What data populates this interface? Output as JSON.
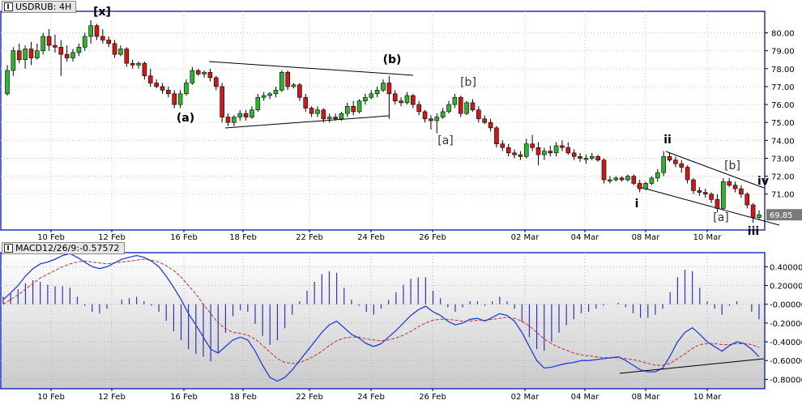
{
  "price_panel": {
    "title": "USDRUB: 4H",
    "last_price_tag": "69.85",
    "colors": {
      "bull": "#2db52d",
      "bear": "#d01818",
      "grid": "#c8c8c8",
      "tag_bg": "#7a7a7a"
    }
  },
  "macd_panel": {
    "title": "MACD12/26/9:-0.57572",
    "colors": {
      "macd": "#1f3fd6",
      "signal": "#c03030",
      "histogram": "#3030c0",
      "bg_top": "#ffffff",
      "bg_bottom": "#c9c9c9"
    }
  },
  "x_axis_labels": [
    "10 Feb",
    "12 Feb",
    "16 Feb",
    "18 Feb",
    "22 Feb",
    "24 Feb",
    "26 Feb",
    "02 Mar",
    "04 Mar",
    "08 Mar",
    "10 Mar"
  ],
  "chart_data": [
    {
      "type": "candlestick",
      "title": "USDRUB: 4H",
      "y_ticks": [
        "80.00",
        "79.00",
        "78.00",
        "77.00",
        "76.00",
        "75.00",
        "74.00",
        "73.00",
        "72.00",
        "71.00"
      ],
      "ylim": [
        69.0,
        81.2
      ],
      "last_price": 69.85,
      "grid": true,
      "wave_labels": [
        "[x]",
        "(a)",
        "(b)",
        "[a]",
        "[b]",
        "ii",
        "i",
        "[b]",
        "[a]",
        "iii",
        "iv"
      ],
      "candles": [
        {
          "o": 76.6,
          "h": 78.2,
          "l": 76.5,
          "c": 77.9
        },
        {
          "o": 77.9,
          "h": 79.2,
          "l": 77.6,
          "c": 79.0
        },
        {
          "o": 79.0,
          "h": 79.4,
          "l": 78.3,
          "c": 78.5
        },
        {
          "o": 78.5,
          "h": 79.3,
          "l": 78.0,
          "c": 79.1
        },
        {
          "o": 79.1,
          "h": 79.5,
          "l": 78.2,
          "c": 78.6
        },
        {
          "o": 78.6,
          "h": 79.4,
          "l": 78.5,
          "c": 79.0
        },
        {
          "o": 79.0,
          "h": 80.0,
          "l": 78.8,
          "c": 79.8
        },
        {
          "o": 79.8,
          "h": 80.2,
          "l": 79.0,
          "c": 79.3
        },
        {
          "o": 79.3,
          "h": 79.9,
          "l": 78.9,
          "c": 79.2
        },
        {
          "o": 79.2,
          "h": 79.6,
          "l": 77.6,
          "c": 78.8
        },
        {
          "o": 78.8,
          "h": 79.3,
          "l": 78.4,
          "c": 78.6
        },
        {
          "o": 78.6,
          "h": 79.1,
          "l": 78.4,
          "c": 78.9
        },
        {
          "o": 78.9,
          "h": 79.4,
          "l": 78.7,
          "c": 79.2
        },
        {
          "o": 79.2,
          "h": 80.0,
          "l": 79.0,
          "c": 79.8
        },
        {
          "o": 79.8,
          "h": 80.7,
          "l": 79.4,
          "c": 80.4
        },
        {
          "o": 80.4,
          "h": 80.5,
          "l": 79.6,
          "c": 79.8
        },
        {
          "o": 79.8,
          "h": 80.2,
          "l": 79.4,
          "c": 79.6
        },
        {
          "o": 79.6,
          "h": 79.8,
          "l": 79.2,
          "c": 79.4
        },
        {
          "o": 79.4,
          "h": 79.6,
          "l": 78.6,
          "c": 78.8
        },
        {
          "o": 78.8,
          "h": 79.3,
          "l": 78.7,
          "c": 79.1
        },
        {
          "o": 79.1,
          "h": 79.2,
          "l": 78.1,
          "c": 78.3
        },
        {
          "o": 78.3,
          "h": 78.5,
          "l": 78.0,
          "c": 78.2
        },
        {
          "o": 78.2,
          "h": 78.4,
          "l": 78.0,
          "c": 78.3
        },
        {
          "o": 78.3,
          "h": 78.4,
          "l": 77.4,
          "c": 77.6
        },
        {
          "o": 77.6,
          "h": 78.0,
          "l": 77.0,
          "c": 77.2
        },
        {
          "o": 77.2,
          "h": 77.4,
          "l": 76.9,
          "c": 77.0
        },
        {
          "o": 77.0,
          "h": 77.2,
          "l": 76.6,
          "c": 76.8
        },
        {
          "o": 76.8,
          "h": 77.0,
          "l": 76.4,
          "c": 76.6
        },
        {
          "o": 76.6,
          "h": 76.8,
          "l": 75.8,
          "c": 76.0
        },
        {
          "o": 76.0,
          "h": 76.8,
          "l": 75.8,
          "c": 76.6
        },
        {
          "o": 76.6,
          "h": 77.4,
          "l": 76.5,
          "c": 77.2
        },
        {
          "o": 77.2,
          "h": 78.1,
          "l": 77.1,
          "c": 77.9
        },
        {
          "o": 77.9,
          "h": 78.0,
          "l": 77.6,
          "c": 77.7
        },
        {
          "o": 77.7,
          "h": 77.9,
          "l": 77.5,
          "c": 77.8
        },
        {
          "o": 77.8,
          "h": 78.0,
          "l": 77.3,
          "c": 77.5
        },
        {
          "o": 77.5,
          "h": 77.6,
          "l": 76.8,
          "c": 77.0
        },
        {
          "o": 77.0,
          "h": 77.2,
          "l": 75.0,
          "c": 75.3
        },
        {
          "o": 75.3,
          "h": 75.5,
          "l": 74.8,
          "c": 75.0
        },
        {
          "o": 75.0,
          "h": 75.4,
          "l": 74.8,
          "c": 75.3
        },
        {
          "o": 75.3,
          "h": 75.7,
          "l": 75.1,
          "c": 75.5
        },
        {
          "o": 75.5,
          "h": 75.7,
          "l": 75.1,
          "c": 75.3
        },
        {
          "o": 75.3,
          "h": 75.9,
          "l": 75.2,
          "c": 75.7
        },
        {
          "o": 75.7,
          "h": 76.6,
          "l": 75.6,
          "c": 76.4
        },
        {
          "o": 76.4,
          "h": 76.7,
          "l": 76.2,
          "c": 76.5
        },
        {
          "o": 76.5,
          "h": 76.7,
          "l": 76.3,
          "c": 76.6
        },
        {
          "o": 76.6,
          "h": 77.0,
          "l": 76.4,
          "c": 76.8
        },
        {
          "o": 76.8,
          "h": 77.9,
          "l": 76.7,
          "c": 77.8
        },
        {
          "o": 77.8,
          "h": 77.9,
          "l": 76.8,
          "c": 77.0
        },
        {
          "o": 77.0,
          "h": 77.2,
          "l": 76.9,
          "c": 77.1
        },
        {
          "o": 77.1,
          "h": 77.2,
          "l": 76.2,
          "c": 76.4
        },
        {
          "o": 76.4,
          "h": 76.6,
          "l": 75.6,
          "c": 75.8
        },
        {
          "o": 75.8,
          "h": 75.9,
          "l": 75.3,
          "c": 75.5
        },
        {
          "o": 75.5,
          "h": 75.9,
          "l": 75.3,
          "c": 75.7
        },
        {
          "o": 75.7,
          "h": 75.8,
          "l": 75.0,
          "c": 75.2
        },
        {
          "o": 75.2,
          "h": 75.5,
          "l": 75.0,
          "c": 75.3
        },
        {
          "o": 75.3,
          "h": 75.5,
          "l": 75.1,
          "c": 75.2
        },
        {
          "o": 75.2,
          "h": 75.6,
          "l": 75.1,
          "c": 75.5
        },
        {
          "o": 75.5,
          "h": 76.1,
          "l": 75.3,
          "c": 75.9
        },
        {
          "o": 75.9,
          "h": 76.2,
          "l": 75.4,
          "c": 75.6
        },
        {
          "o": 75.6,
          "h": 76.3,
          "l": 75.5,
          "c": 76.2
        },
        {
          "o": 76.2,
          "h": 76.6,
          "l": 76.0,
          "c": 76.4
        },
        {
          "o": 76.4,
          "h": 76.8,
          "l": 76.3,
          "c": 76.6
        },
        {
          "o": 76.6,
          "h": 77.0,
          "l": 76.4,
          "c": 76.8
        },
        {
          "o": 76.8,
          "h": 77.4,
          "l": 76.7,
          "c": 77.2
        },
        {
          "o": 77.2,
          "h": 77.6,
          "l": 75.2,
          "c": 76.6
        },
        {
          "o": 76.6,
          "h": 76.8,
          "l": 76.0,
          "c": 76.2
        },
        {
          "o": 76.2,
          "h": 76.4,
          "l": 75.9,
          "c": 76.1
        },
        {
          "o": 76.1,
          "h": 76.7,
          "l": 76.0,
          "c": 76.5
        },
        {
          "o": 76.5,
          "h": 76.6,
          "l": 75.8,
          "c": 76.0
        },
        {
          "o": 76.0,
          "h": 76.2,
          "l": 75.4,
          "c": 75.6
        },
        {
          "o": 75.6,
          "h": 75.7,
          "l": 75.0,
          "c": 75.2
        },
        {
          "o": 75.2,
          "h": 75.4,
          "l": 74.6,
          "c": 75.1
        },
        {
          "o": 75.1,
          "h": 75.5,
          "l": 74.4,
          "c": 75.3
        },
        {
          "o": 75.3,
          "h": 75.8,
          "l": 75.2,
          "c": 75.6
        },
        {
          "o": 75.6,
          "h": 76.2,
          "l": 75.5,
          "c": 76.0
        },
        {
          "o": 76.0,
          "h": 76.6,
          "l": 75.8,
          "c": 76.4
        },
        {
          "o": 76.4,
          "h": 76.5,
          "l": 75.3,
          "c": 75.5
        },
        {
          "o": 75.5,
          "h": 76.2,
          "l": 75.4,
          "c": 76.1
        },
        {
          "o": 76.1,
          "h": 76.3,
          "l": 75.6,
          "c": 75.7
        },
        {
          "o": 75.7,
          "h": 75.9,
          "l": 75.0,
          "c": 75.2
        },
        {
          "o": 75.2,
          "h": 75.4,
          "l": 74.9,
          "c": 75.0
        },
        {
          "o": 75.0,
          "h": 75.2,
          "l": 74.5,
          "c": 74.7
        },
        {
          "o": 74.7,
          "h": 74.8,
          "l": 73.6,
          "c": 73.8
        },
        {
          "o": 73.8,
          "h": 74.0,
          "l": 73.4,
          "c": 73.6
        },
        {
          "o": 73.6,
          "h": 73.8,
          "l": 73.1,
          "c": 73.3
        },
        {
          "o": 73.3,
          "h": 73.5,
          "l": 73.0,
          "c": 73.2
        },
        {
          "o": 73.2,
          "h": 73.4,
          "l": 72.9,
          "c": 73.1
        },
        {
          "o": 73.1,
          "h": 74.1,
          "l": 73.0,
          "c": 73.8
        },
        {
          "o": 73.8,
          "h": 74.3,
          "l": 73.4,
          "c": 73.6
        },
        {
          "o": 73.6,
          "h": 73.9,
          "l": 72.6,
          "c": 73.2
        },
        {
          "o": 73.2,
          "h": 73.6,
          "l": 72.9,
          "c": 73.4
        },
        {
          "o": 73.4,
          "h": 73.7,
          "l": 73.1,
          "c": 73.3
        },
        {
          "o": 73.3,
          "h": 73.9,
          "l": 73.1,
          "c": 73.7
        },
        {
          "o": 73.7,
          "h": 74.0,
          "l": 73.4,
          "c": 73.6
        },
        {
          "o": 73.6,
          "h": 73.9,
          "l": 73.2,
          "c": 73.3
        },
        {
          "o": 73.3,
          "h": 73.5,
          "l": 72.9,
          "c": 73.1
        },
        {
          "o": 73.1,
          "h": 73.3,
          "l": 72.8,
          "c": 73.0
        },
        {
          "o": 73.0,
          "h": 73.2,
          "l": 72.7,
          "c": 73.0
        },
        {
          "o": 73.0,
          "h": 73.3,
          "l": 72.9,
          "c": 73.1
        },
        {
          "o": 73.1,
          "h": 73.2,
          "l": 72.8,
          "c": 72.9
        },
        {
          "o": 72.9,
          "h": 73.0,
          "l": 71.6,
          "c": 71.8
        },
        {
          "o": 71.8,
          "h": 72.0,
          "l": 71.6,
          "c": 71.8
        },
        {
          "o": 71.8,
          "h": 72.0,
          "l": 71.7,
          "c": 71.9
        },
        {
          "o": 71.9,
          "h": 72.0,
          "l": 71.7,
          "c": 71.8
        },
        {
          "o": 71.8,
          "h": 72.1,
          "l": 71.7,
          "c": 72.0
        },
        {
          "o": 72.0,
          "h": 72.1,
          "l": 71.5,
          "c": 71.6
        },
        {
          "o": 71.6,
          "h": 71.8,
          "l": 71.1,
          "c": 71.3
        },
        {
          "o": 71.3,
          "h": 71.7,
          "l": 71.2,
          "c": 71.6
        },
        {
          "o": 71.6,
          "h": 72.0,
          "l": 71.5,
          "c": 71.9
        },
        {
          "o": 71.9,
          "h": 72.4,
          "l": 71.7,
          "c": 72.2
        },
        {
          "o": 72.2,
          "h": 73.4,
          "l": 72.0,
          "c": 73.1
        },
        {
          "o": 73.1,
          "h": 73.3,
          "l": 72.8,
          "c": 72.9
        },
        {
          "o": 72.9,
          "h": 73.1,
          "l": 72.5,
          "c": 72.7
        },
        {
          "o": 72.7,
          "h": 72.9,
          "l": 72.2,
          "c": 72.5
        },
        {
          "o": 72.5,
          "h": 72.6,
          "l": 71.6,
          "c": 71.8
        },
        {
          "o": 71.8,
          "h": 71.9,
          "l": 71.0,
          "c": 71.2
        },
        {
          "o": 71.2,
          "h": 71.4,
          "l": 70.9,
          "c": 71.1
        },
        {
          "o": 71.1,
          "h": 71.3,
          "l": 70.8,
          "c": 71.0
        },
        {
          "o": 71.0,
          "h": 71.1,
          "l": 70.5,
          "c": 70.7
        },
        {
          "o": 70.7,
          "h": 71.0,
          "l": 70.0,
          "c": 70.2
        },
        {
          "o": 70.2,
          "h": 71.9,
          "l": 70.1,
          "c": 71.7
        },
        {
          "o": 71.7,
          "h": 71.9,
          "l": 71.4,
          "c": 71.5
        },
        {
          "o": 71.5,
          "h": 71.7,
          "l": 71.1,
          "c": 71.3
        },
        {
          "o": 71.3,
          "h": 71.5,
          "l": 70.8,
          "c": 71.0
        },
        {
          "o": 71.0,
          "h": 71.1,
          "l": 70.2,
          "c": 70.4
        },
        {
          "o": 70.4,
          "h": 70.5,
          "l": 69.4,
          "c": 69.7
        },
        {
          "o": 69.7,
          "h": 70.1,
          "l": 69.6,
          "c": 69.85
        }
      ]
    },
    {
      "type": "line",
      "title": "MACD12/26/9:-0.57572",
      "y_ticks": [
        "0.40000",
        "0.20000",
        "-0.00000",
        "-0.20000",
        "-0.40000",
        "-0.60000",
        "-0.80000"
      ],
      "ylim": [
        -0.9,
        0.55
      ],
      "grid": true,
      "series": [
        {
          "kind": "line",
          "values": [
            0.05,
            0.12,
            0.2,
            0.3,
            0.38,
            0.43,
            0.45,
            0.48,
            0.52,
            0.54,
            0.5,
            0.45,
            0.4,
            0.38,
            0.4,
            0.44,
            0.48,
            0.5,
            0.52,
            0.5,
            0.46,
            0.4,
            0.3,
            0.18,
            0.05,
            -0.1,
            -0.22,
            -0.35,
            -0.48,
            -0.52,
            -0.45,
            -0.38,
            -0.35,
            -0.38,
            -0.5,
            -0.65,
            -0.78,
            -0.82,
            -0.78,
            -0.7,
            -0.6,
            -0.5,
            -0.4,
            -0.3,
            -0.22,
            -0.18,
            -0.25,
            -0.32,
            -0.36,
            -0.42,
            -0.45,
            -0.42,
            -0.35,
            -0.28,
            -0.2,
            -0.12,
            -0.06,
            -0.02,
            -0.08,
            -0.12,
            -0.18,
            -0.22,
            -0.2,
            -0.16,
            -0.15,
            -0.18,
            -0.14,
            -0.1,
            -0.12,
            -0.18,
            -0.3,
            -0.45,
            -0.6,
            -0.68,
            -0.67,
            -0.65,
            -0.63,
            -0.62,
            -0.6,
            -0.6,
            -0.59,
            -0.58,
            -0.57,
            -0.56,
            -0.6,
            -0.65,
            -0.7,
            -0.72,
            -0.72,
            -0.68,
            -0.55,
            -0.4,
            -0.3,
            -0.25,
            -0.32,
            -0.4,
            -0.45,
            -0.5,
            -0.44,
            -0.4,
            -0.42,
            -0.48,
            -0.56
          ]
        },
        {
          "kind": "signal",
          "values": [
            0.0,
            0.05,
            0.1,
            0.16,
            0.22,
            0.28,
            0.32,
            0.36,
            0.4,
            0.43,
            0.45,
            0.46,
            0.45,
            0.44,
            0.43,
            0.44,
            0.45,
            0.46,
            0.47,
            0.48,
            0.47,
            0.45,
            0.41,
            0.36,
            0.29,
            0.2,
            0.11,
            0.0,
            -0.1,
            -0.2,
            -0.26,
            -0.3,
            -0.31,
            -0.33,
            -0.37,
            -0.44,
            -0.51,
            -0.58,
            -0.62,
            -0.63,
            -0.62,
            -0.59,
            -0.55,
            -0.5,
            -0.44,
            -0.39,
            -0.36,
            -0.35,
            -0.35,
            -0.37,
            -0.38,
            -0.39,
            -0.38,
            -0.36,
            -0.33,
            -0.29,
            -0.24,
            -0.2,
            -0.17,
            -0.16,
            -0.16,
            -0.17,
            -0.18,
            -0.18,
            -0.17,
            -0.17,
            -0.16,
            -0.15,
            -0.14,
            -0.15,
            -0.18,
            -0.23,
            -0.3,
            -0.37,
            -0.42,
            -0.46,
            -0.49,
            -0.52,
            -0.54,
            -0.55,
            -0.56,
            -0.57,
            -0.57,
            -0.57,
            -0.58,
            -0.59,
            -0.61,
            -0.63,
            -0.65,
            -0.65,
            -0.63,
            -0.58,
            -0.53,
            -0.47,
            -0.43,
            -0.42,
            -0.42,
            -0.43,
            -0.43,
            -0.42,
            -0.42,
            -0.43,
            -0.46
          ]
        }
      ]
    }
  ]
}
